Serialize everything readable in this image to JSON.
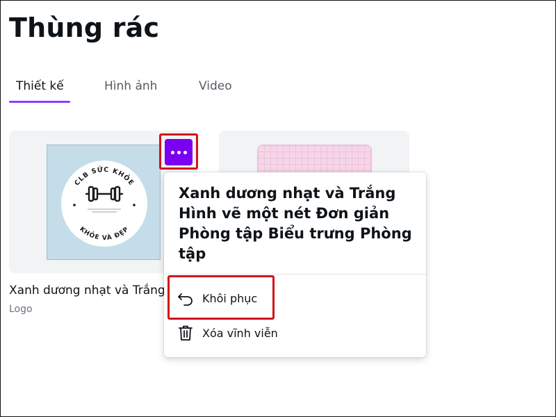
{
  "page": {
    "title": "Thùng rác"
  },
  "tabs": [
    {
      "label": "Thiết kế",
      "active": true
    },
    {
      "label": "Hình ảnh",
      "active": false
    },
    {
      "label": "Video",
      "active": false
    }
  ],
  "accent_color": "#8b3dff",
  "more_button_color": "#7a00ef",
  "highlight_color": "#d0141b",
  "cards": [
    {
      "title": "Xanh dương nhạt và Trắng Hình vẽ một nét Đơn giản Phòng tập Biểu trưng Phòng tập",
      "type": "Logo",
      "thumbnail": {
        "top_text": "CLB SỨC KHỎE",
        "bottom_text": "KHỎE VÀ ĐẸP",
        "icon": "dumbbell-icon"
      }
    },
    {
      "thumbnail": {
        "pattern": "pink-grid"
      }
    }
  ],
  "context_menu": {
    "title": "Xanh dương nhạt và Trắng Hình vẽ một nét Đơn giản Phòng tập Biểu trưng Phòng tập",
    "items": [
      {
        "label": "Khôi phục",
        "icon": "undo-arrow-icon"
      },
      {
        "label": "Xóa vĩnh viễn",
        "icon": "trash-icon"
      }
    ]
  }
}
